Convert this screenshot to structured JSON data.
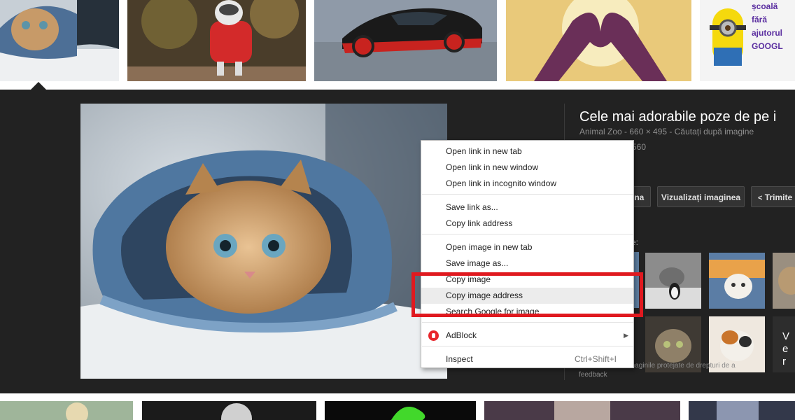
{
  "top_thumbnails": [
    {
      "icon": "kitten-in-jeans-thumbnail"
    },
    {
      "icon": "husky-puppy-red-hoodie-thumbnail"
    },
    {
      "icon": "black-red-sports-car-thumbnail"
    },
    {
      "icon": "heart-hands-sunset-thumbnail"
    },
    {
      "icon": "minion-quote-thumbnail",
      "caption": [
        "școală",
        "fără",
        "ajutorul",
        "GOOGL"
      ]
    }
  ],
  "preview": {
    "title": "Cele mai adorabile poze de pe i",
    "meta": "Animal Zoo - 660 × 495 - Căutați după imagine",
    "meta2": "560",
    "buttons": [
      "ina",
      "Vizualizați imaginea",
      "Trimite"
    ],
    "related_label": "re:",
    "related_overlay": "Ve r",
    "copyright_note": "este imaginile protejate de drepturi de a",
    "feedback": "feedback"
  },
  "context_menu": {
    "groups": [
      [
        "Open link in new tab",
        "Open link in new window",
        "Open link in incognito window"
      ],
      [
        "Save link as...",
        "Copy link address"
      ],
      [
        "Open image in new tab",
        "Save image as...",
        "Copy image",
        "Copy image address",
        "Search Google for image"
      ],
      [
        "AdBlock"
      ],
      [
        "Inspect"
      ]
    ],
    "inspect_shortcut": "Ctrl+Shift+I",
    "hovered_item": "Copy image address",
    "highlight_color": "#e0191f"
  },
  "colors": {
    "panel_bg": "#222222",
    "menu_bg": "#ffffff",
    "adblock_red": "#e8272c"
  }
}
